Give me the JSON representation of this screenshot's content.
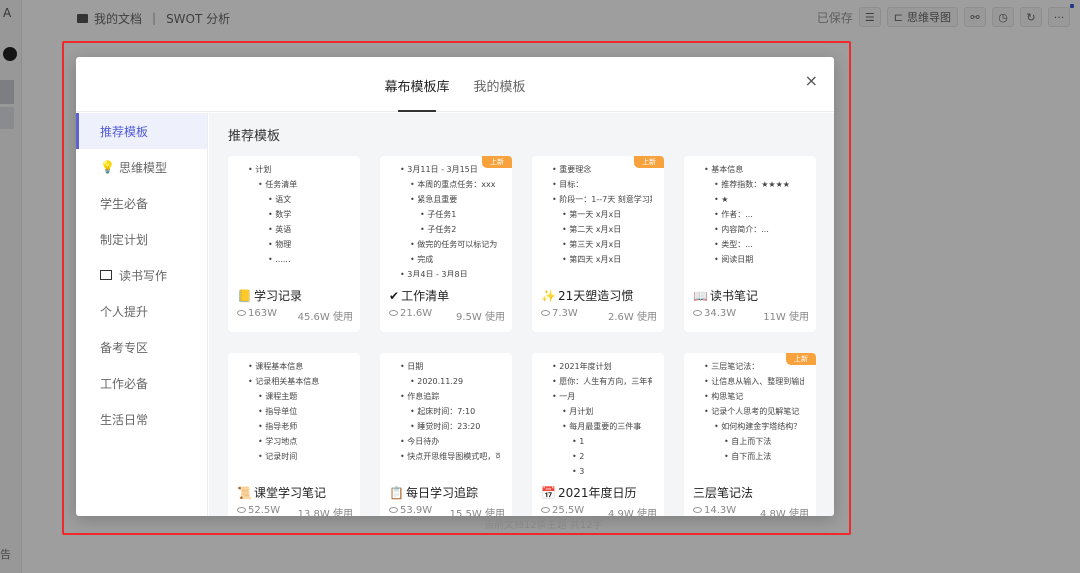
{
  "left_bar": {
    "bottom_text": "告"
  },
  "breadcrumb": {
    "folder": "我的文档",
    "separator": "|",
    "doc": "SWOT 分析"
  },
  "toolbar": {
    "saved": "已保存",
    "mindmap_label": "思维导图",
    "more": "···"
  },
  "modal": {
    "tabs": [
      "幕布模板库",
      "我的模板"
    ],
    "active_tab": 0,
    "close": "×",
    "section_title": "推荐模板"
  },
  "sidebar": {
    "items": [
      {
        "label": "推荐模板",
        "icon": ""
      },
      {
        "label": "思维模型",
        "icon": "lightbulb-icon"
      },
      {
        "label": "学生必备",
        "icon": ""
      },
      {
        "label": "制定计划",
        "icon": ""
      },
      {
        "label": "读书写作",
        "icon": "book-icon"
      },
      {
        "label": "个人提升",
        "icon": ""
      },
      {
        "label": "备考专区",
        "icon": ""
      },
      {
        "label": "工作必备",
        "icon": ""
      },
      {
        "label": "生活日常",
        "icon": ""
      }
    ]
  },
  "cards": [
    {
      "title": "学习记录",
      "icon": "notebook-icon",
      "views": "163W",
      "uses": "45.6W 使用",
      "badge": "",
      "preview": [
        [
          "计划",
          0
        ],
        [
          "任务清单",
          1
        ],
        [
          "语文",
          2
        ],
        [
          "数学",
          2
        ],
        [
          "英语",
          2
        ],
        [
          "物理",
          2
        ],
        [
          "......",
          2
        ]
      ]
    },
    {
      "title": "工作清单",
      "icon": "checkmark-icon",
      "views": "21.6W",
      "uses": "9.5W 使用",
      "badge": "上新",
      "preview": [
        [
          "3月11日 - 3月15日",
          0
        ],
        [
          "本周的重点任务：xxx",
          1
        ],
        [
          "紧急且重要",
          1
        ],
        [
          "子任务1",
          2
        ],
        [
          "子任务2",
          2
        ],
        [
          "做完的任务可以标记为",
          1
        ],
        [
          "完成",
          1
        ],
        [
          "3月4日 - 3月8日",
          0
        ]
      ]
    },
    {
      "title": "21天塑造习惯",
      "icon": "star-icon",
      "views": "7.3W",
      "uses": "2.6W 使用",
      "badge": "上新",
      "preview": [
        [
          "重要理念",
          0
        ],
        [
          "目标：",
          0
        ],
        [
          "阶段一：1--7天 刻意学习期",
          0
        ],
        [
          "第一天 x月x日",
          1
        ],
        [
          "第二天 x月x日",
          1
        ],
        [
          "第三天 x月x日",
          1
        ],
        [
          "第四天 x月x日",
          1
        ]
      ]
    },
    {
      "title": "读书笔记",
      "icon": "book-icon",
      "views": "34.3W",
      "uses": "11W 使用",
      "badge": "",
      "preview": [
        [
          "基本信息",
          0
        ],
        [
          "推荐指数：★★★★",
          1
        ],
        [
          "★",
          1
        ],
        [
          "作者：...",
          1
        ],
        [
          "内容简介：...",
          1
        ],
        [
          "类型：...",
          1
        ],
        [
          "阅读日期",
          1
        ]
      ]
    },
    {
      "title": "课堂学习笔记",
      "icon": "scroll-icon",
      "views": "52.5W",
      "uses": "13.8W 使用",
      "badge": "",
      "preview": [
        [
          "课程基本信息",
          0
        ],
        [
          "记录相关基本信息",
          0
        ],
        [
          "课程主题",
          1
        ],
        [
          "指导单位",
          1
        ],
        [
          "指导老师",
          1
        ],
        [
          "学习地点",
          1
        ],
        [
          "记录时间",
          1
        ]
      ]
    },
    {
      "title": "每日学习追踪",
      "icon": "clipboard-icon",
      "views": "53.9W",
      "uses": "15.5W 使用",
      "badge": "",
      "preview": [
        [
          "日期",
          0
        ],
        [
          "2020.11.29",
          1
        ],
        [
          "作息追踪",
          0
        ],
        [
          "起床时间：7:10",
          1
        ],
        [
          "睡觉时间：23:20",
          1
        ],
        [
          "今日待办",
          0
        ],
        [
          "快点开思维导图模式吧，可...",
          0
        ]
      ]
    },
    {
      "title": "2021年度日历",
      "icon": "calendar-icon",
      "views": "25.5W",
      "uses": "4.9W 使用",
      "badge": "",
      "preview": [
        [
          "2021年度计划",
          0
        ],
        [
          "愿你：人生有方向，三年有...",
          0
        ],
        [
          "一月",
          0
        ],
        [
          "月计划",
          1
        ],
        [
          "每月最重要的三件事",
          1
        ],
        [
          "1",
          2
        ],
        [
          "2",
          2
        ],
        [
          "3",
          2
        ]
      ]
    },
    {
      "title": "三层笔记法",
      "icon": "",
      "views": "14.3W",
      "uses": "4.8W 使用",
      "badge": "上新",
      "preview": [
        [
          "三层笔记法：",
          0
        ],
        [
          "让信息从输入、整理到输出...",
          0
        ],
        [
          "构思笔记",
          0
        ],
        [
          "记录个人思考的见解笔记",
          0
        ],
        [
          "如何构建金字塔结构？",
          1
        ],
        [
          "自上而下法",
          2
        ],
        [
          "自下而上法",
          2
        ]
      ]
    }
  ],
  "footer_note": "当前文档12条主题 共12字"
}
